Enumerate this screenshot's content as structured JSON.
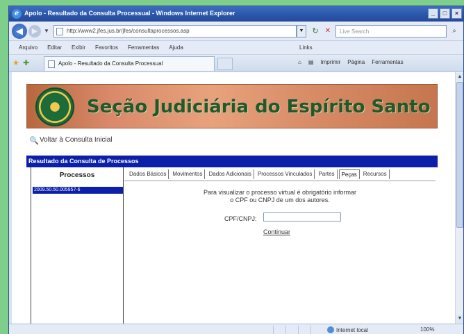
{
  "window": {
    "title": "Apolo - Resultado da Consulta Processual - Windows Internet Explorer",
    "min": "_",
    "max": "□",
    "close": "×"
  },
  "address": {
    "url": "http://www2.jfes.jus.br/jfes/consultaprocessos.asp",
    "search_placeholder": "Live Search"
  },
  "menu": {
    "items": [
      "Arquivo",
      "Editar",
      "Exibir",
      "Favoritos",
      "Ferramentas",
      "Ajuda"
    ],
    "links_label": "Links"
  },
  "tab": {
    "label": "Apolo - Resultado da Consulta Processual"
  },
  "command_bar": {
    "home": "⌂",
    "feeds": "▤",
    "print": "Imprimir",
    "page": "Página",
    "tools": "Ferramentas"
  },
  "page": {
    "banner_text": "Seção Judiciária do Espírito Santo",
    "back_link": "Voltar à Consulta Inicial",
    "result_header": "Resultado da Consulta de Processos",
    "processos_heading": "Processos",
    "process_number": "2009.50.50.005957-6",
    "tabs": [
      "Dados Básicos",
      "Movimentos",
      "Dados Adicionais",
      "Processos Vinculados",
      "Partes",
      "Peças",
      "Recursos"
    ],
    "active_tab_index": 5,
    "message_line1": "Para visualizar o processo virtual é obrigatório informar",
    "message_line2": "o CPF ou CNPJ de um dos autores.",
    "cpf_label": "CPF/CNPJ:",
    "cpf_value": "",
    "continue_link": "Continuar"
  },
  "status": {
    "zone": "Internet local",
    "zoom": "100%"
  },
  "colors": {
    "header_blue": "#0b1fa8",
    "banner_green": "#1f5a2c"
  }
}
